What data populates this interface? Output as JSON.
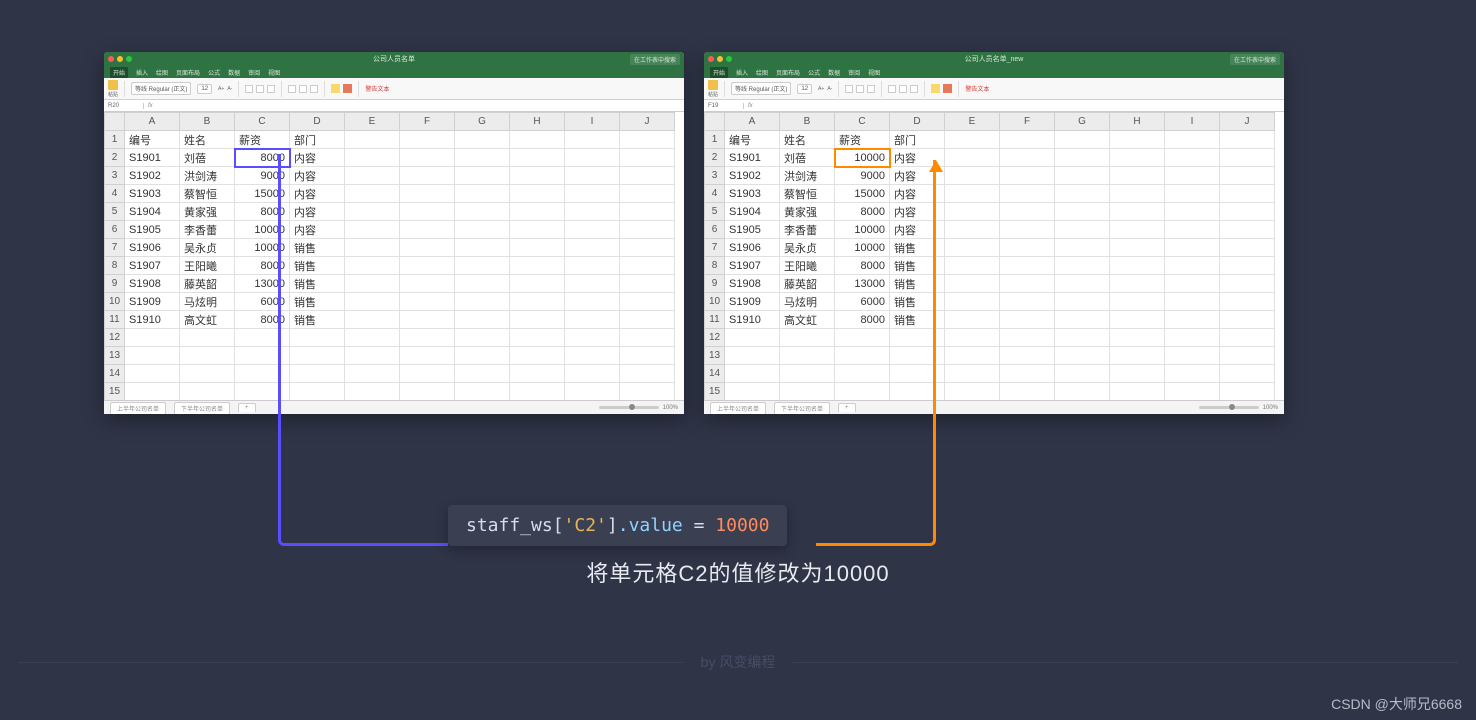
{
  "left": {
    "title": "公司人员名单",
    "search_hint": "在工作表中搜索",
    "menu": [
      "开始",
      "插入",
      "绘图",
      "页面布局",
      "公式",
      "数据",
      "审阅",
      "视图"
    ],
    "font_name": "等线 Regular (正文)",
    "font_size": "12",
    "warn": "警告文本",
    "cell_ref": "R20",
    "columns": [
      "A",
      "B",
      "C",
      "D",
      "E",
      "F",
      "G",
      "H",
      "I",
      "J"
    ],
    "headers": [
      "编号",
      "姓名",
      "薪资",
      "部门"
    ],
    "rows": [
      [
        "S1901",
        "刘蓓",
        "8000",
        "内容"
      ],
      [
        "S1902",
        "洪剑涛",
        "9000",
        "内容"
      ],
      [
        "S1903",
        "蔡智恒",
        "15000",
        "内容"
      ],
      [
        "S1904",
        "黄家强",
        "8000",
        "内容"
      ],
      [
        "S1905",
        "李香蕾",
        "10000",
        "内容"
      ],
      [
        "S1906",
        "吴永贞",
        "10000",
        "销售"
      ],
      [
        "S1907",
        "王阳曦",
        "8000",
        "销售"
      ],
      [
        "S1908",
        "藤英韶",
        "13000",
        "销售"
      ],
      [
        "S1909",
        "马炫明",
        "6000",
        "销售"
      ],
      [
        "S1910",
        "高文虹",
        "8000",
        "销售"
      ]
    ],
    "sheets": [
      "上半年公司名单",
      "下半年公司名单",
      "+"
    ],
    "zoom": "100%"
  },
  "right": {
    "title": "公司人员名单_new",
    "search_hint": "在工作表中搜索",
    "menu": [
      "开始",
      "插入",
      "绘图",
      "页面布局",
      "公式",
      "数据",
      "审阅",
      "视图"
    ],
    "font_name": "等线 Regular (正文)",
    "font_size": "12",
    "warn": "警告文本",
    "cell_ref": "F19",
    "columns": [
      "A",
      "B",
      "C",
      "D",
      "E",
      "F",
      "G",
      "H",
      "I",
      "J"
    ],
    "headers": [
      "编号",
      "姓名",
      "薪资",
      "部门"
    ],
    "rows": [
      [
        "S1901",
        "刘蓓",
        "10000",
        "内容"
      ],
      [
        "S1902",
        "洪剑涛",
        "9000",
        "内容"
      ],
      [
        "S1903",
        "蔡智恒",
        "15000",
        "内容"
      ],
      [
        "S1904",
        "黄家强",
        "8000",
        "内容"
      ],
      [
        "S1905",
        "李香蕾",
        "10000",
        "内容"
      ],
      [
        "S1906",
        "吴永贞",
        "10000",
        "销售"
      ],
      [
        "S1907",
        "王阳曦",
        "8000",
        "销售"
      ],
      [
        "S1908",
        "藤英韶",
        "13000",
        "销售"
      ],
      [
        "S1909",
        "马炫明",
        "6000",
        "销售"
      ],
      [
        "S1910",
        "高文虹",
        "8000",
        "销售"
      ]
    ],
    "sheets": [
      "上半年公司名单",
      "下半年公司名单",
      "+"
    ],
    "zoom": "100%"
  },
  "code": {
    "obj": "staff_ws",
    "key": "'C2'",
    "prop": ".value",
    "eq": " = ",
    "val": "10000"
  },
  "caption": "将单元格C2的值修改为10000",
  "brand": "by 风变编程",
  "watermark": "CSDN @大师兄6668"
}
